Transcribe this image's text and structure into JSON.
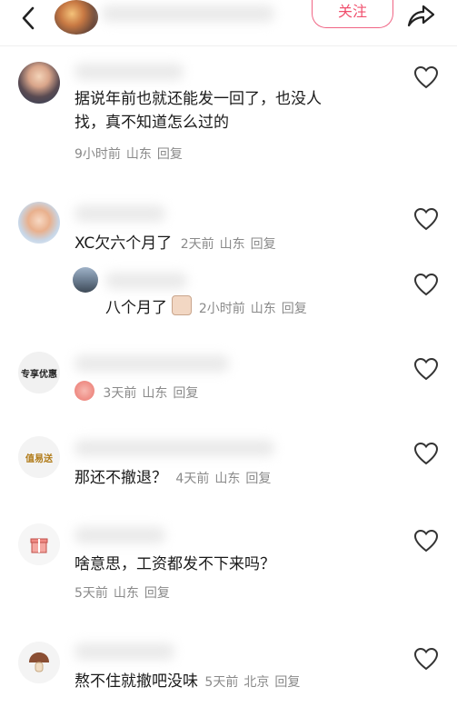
{
  "header": {
    "follow_label": "关注"
  },
  "comments": [
    {
      "text_line1": "据说年前也就还能发一回了，也没人",
      "text_line2": "找，真不知道怎么过的",
      "time": "9小时前",
      "location": "山东",
      "reply_label": "回复"
    },
    {
      "text": "XC欠六个月了",
      "time": "2天前",
      "location": "山东",
      "reply_label": "回复"
    },
    {
      "text": "八个月了",
      "time": "2小时前",
      "location": "山东",
      "reply_label": "回复"
    },
    {
      "avatar_text": "专享优惠",
      "time": "3天前",
      "location": "山东",
      "reply_label": "回复"
    },
    {
      "avatar_text": "值易送",
      "text": "那还不撤退？",
      "time": "4天前",
      "location": "山东",
      "reply_label": "回复"
    },
    {
      "text": "啥意思，工资都发不下来吗？",
      "time": "5天前",
      "location": "山东",
      "reply_label": "回复"
    },
    {
      "text": "熬不住就撤吧没味",
      "time": "5天前",
      "location": "北京",
      "reply_label": "回复"
    }
  ],
  "colors": {
    "accent": "#f0506e",
    "meta": "#8a8a8a"
  },
  "icons": [
    "back-arrow-icon",
    "share-icon",
    "heart-icon",
    "gift-icon",
    "mushroom-icon",
    "emoji-sticker-icon"
  ]
}
